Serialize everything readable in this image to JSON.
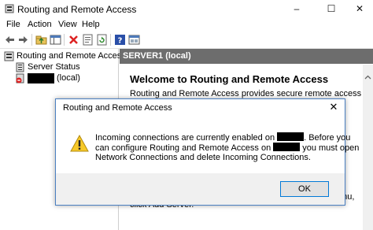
{
  "window": {
    "title": "Routing and Remote Access",
    "controls": [
      "–",
      "☐",
      "✕"
    ]
  },
  "menu": [
    "File",
    "Action",
    "View",
    "Help"
  ],
  "toolbar": [
    "back-arrow-icon",
    "forward-arrow-icon",
    "up-folder-icon",
    "show-hide-tree-icon",
    "delete-icon",
    "properties-icon",
    "refresh-icon",
    "help-icon",
    "console-icon"
  ],
  "tree": {
    "root": "Routing and Remote Access",
    "items": [
      {
        "label": "Server Status"
      },
      {
        "label": "(local)"
      }
    ]
  },
  "right_pane": {
    "header": "SERVER1 (local)",
    "welcome_title": "Welcome to Routing and Remote Access",
    "welcome_text": "Routing and Remote Access provides secure remote access to",
    "fragment_1": "enu,",
    "fragment_2": "click Add Server."
  },
  "dialog": {
    "title": "Routing and Remote Access",
    "close": "✕",
    "line1_a": "Incoming connections are currently enabled on",
    "line1_b": ". Before you",
    "line2_a": "can configure Routing and Remote Access on",
    "line2_b": "you must open",
    "line3": "Network Connections and delete Incoming Connections.",
    "ok_label": "OK"
  },
  "colors": {
    "header_bg": "#6d6d6d",
    "dialog_border": "#4a7fc1",
    "ok_border": "#0078d7",
    "footer_bg": "#f0f0f0"
  }
}
